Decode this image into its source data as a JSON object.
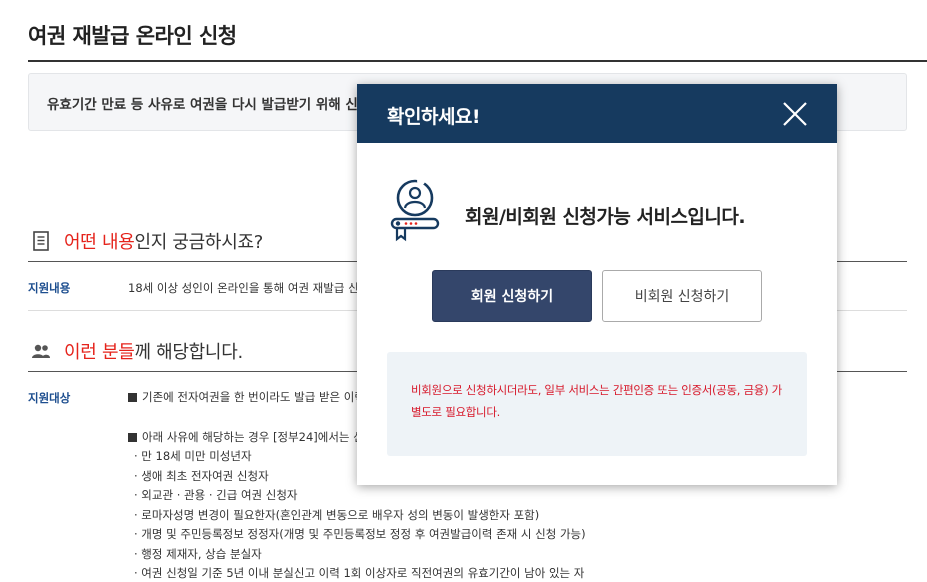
{
  "page": {
    "title": "여권 재발급 온라인 신청",
    "notice": "유효기간 만료 등 사유로 여권을 다시 발급받기 위해 신"
  },
  "section_content": {
    "heading_highlight": "어떤 내용",
    "heading_rest": "인지 궁금하시죠?",
    "icon": "document-icon",
    "row_label": "지원내용",
    "row_text": "18세 이상 성인이 온라인을 통해 여권 재발급 신청"
  },
  "section_target": {
    "heading_highlight": "이런 분들",
    "heading_rest": "께 해당합니다.",
    "icon": "people-icon",
    "row_label": "지원대상",
    "line1": "기존에 전자여권을 한 번이라도 발급 받은 이력",
    "line2": "아래 사유에 해당하는 경우 [정부24]에서는 신",
    "items": [
      "· 만 18세 미만 미성년자",
      "· 생애 최초 전자여권 신청자",
      "· 외교관 · 관용 · 긴급 여권 신청자",
      "· 로마자성명 변경이 필요한자(혼인관계 변동으로 배우자 성의 변동이 발생한자 포함)",
      "· 개명 및 주민등록정보 정정자(개명 및 주민등록정보 정정 후 여권발급이력 존재 시 신청 가능)",
      "· 행정 제재자, 상습 분실자",
      "· 여권 신청일 기준 5년 이내 분실신고 이력 1회 이상자로 직전여권의 유효기간이 남아 있는 자"
    ]
  },
  "modal": {
    "title": "확인하세요!",
    "message": "회원/비회원 신청가능 서비스입니다.",
    "member_button": "회원 신청하기",
    "guest_button": "비회원 신청하기",
    "note": "비회원으로 신청하시더라도, 일부 서비스는 간편인증 또는 인증서(공동, 금융) 가 별도로 필요합니다.",
    "icons": [
      "close-icon",
      "user-key-icon"
    ]
  },
  "colors": {
    "header_bg": "#163a5f",
    "primary_button": "#34466b",
    "highlight_red": "#e5231b",
    "label_blue": "#1d4e8f",
    "note_text": "#d7192b",
    "note_bg": "#eef3f7"
  }
}
